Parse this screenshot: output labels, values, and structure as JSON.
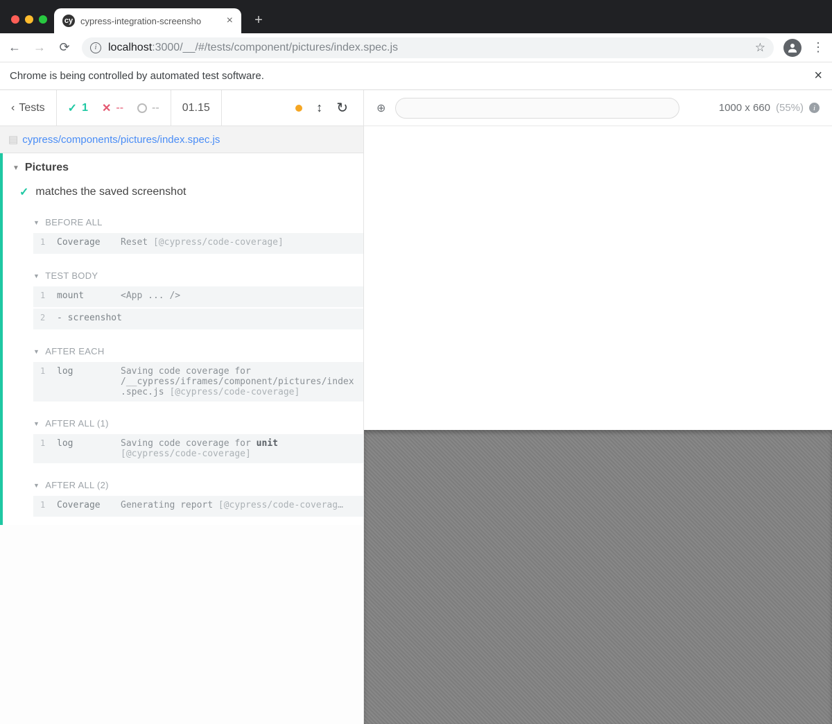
{
  "browser": {
    "tab_title": "cypress-integration-screensho",
    "url_host": "localhost",
    "url_port_path": ":3000/__/#/tests/component/pictures/index.spec.js",
    "auto_banner": "Chrome is being controlled by automated test software."
  },
  "toolbar": {
    "tests_label": "Tests",
    "pass_count": "1",
    "fail_count": "--",
    "pending_count": "--",
    "duration": "01.15"
  },
  "file_path": "cypress/components/pictures/index.spec.js",
  "suite": {
    "title": "Pictures",
    "test": "matches the saved screenshot",
    "hooks": {
      "before_all": {
        "label": "BEFORE ALL",
        "cmds": [
          {
            "n": "1",
            "name": "Coverage",
            "msg": "Reset ",
            "suffix": "[@cypress/code-coverage]"
          }
        ]
      },
      "test_body": {
        "label": "TEST BODY",
        "cmds": [
          {
            "n": "1",
            "name": "mount",
            "msg": "<App ... />"
          },
          {
            "n": "2",
            "name": "- screenshot",
            "msg": ""
          }
        ]
      },
      "after_each": {
        "label": "AFTER EACH",
        "cmds": [
          {
            "n": "1",
            "name": "log",
            "msg_pre": "Saving code coverage for\n/__cypress/iframes/component/pictures/index.spec.js ",
            "msg_suf": "[@cypress/code-coverage]"
          }
        ]
      },
      "after_all_1": {
        "label": "AFTER ALL (1)",
        "cmds": [
          {
            "n": "1",
            "name": "log",
            "msg_pre": "Saving code coverage for ",
            "msg_strong": "unit",
            "msg_suf": "\n[@cypress/code-coverage]"
          }
        ]
      },
      "after_all_2": {
        "label": "AFTER ALL (2)",
        "cmds": [
          {
            "n": "1",
            "name": "Coverage",
            "msg": "Generating report ",
            "suffix": "[@cypress/code-coverag…"
          }
        ]
      }
    }
  },
  "aut": {
    "viewport": "1000 x 660",
    "scale": "(55%)"
  }
}
